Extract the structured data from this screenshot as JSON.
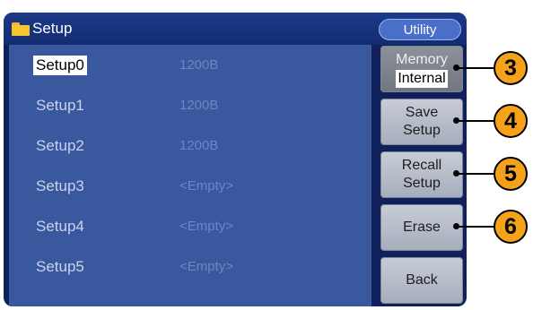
{
  "header": {
    "title": "Setup",
    "mode_label": "Utility"
  },
  "setups": [
    {
      "name": "Setup0",
      "size": "1200B",
      "selected": true
    },
    {
      "name": "Setup1",
      "size": "1200B",
      "selected": false
    },
    {
      "name": "Setup2",
      "size": "1200B",
      "selected": false
    },
    {
      "name": "Setup3",
      "size": "<Empty>",
      "selected": false
    },
    {
      "name": "Setup4",
      "size": "<Empty>",
      "selected": false
    },
    {
      "name": "Setup5",
      "size": "<Empty>",
      "selected": false
    }
  ],
  "softkeys": {
    "memory": {
      "label": "Memory",
      "value": "Internal"
    },
    "save": {
      "line1": "Save",
      "line2": "Setup"
    },
    "recall": {
      "line1": "Recall",
      "line2": "Setup"
    },
    "erase": {
      "label": "Erase"
    },
    "back": {
      "label": "Back"
    }
  },
  "callouts": [
    "3",
    "4",
    "5",
    "6"
  ],
  "colors": {
    "callout": "#f5a21a",
    "screen_bg": "#10205a",
    "list_bg": "#3a589e"
  }
}
